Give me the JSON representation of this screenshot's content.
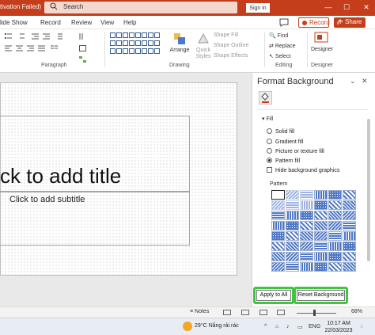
{
  "titlebar": {
    "title": "tivation Failed)",
    "search_placeholder": "Search",
    "signin_label": "Sign in",
    "minimize": "—",
    "maximize": "☐",
    "close": "✕"
  },
  "menu": {
    "items": [
      "lide Show",
      "Record",
      "Review",
      "View",
      "Help"
    ],
    "record_label": "Record",
    "share_label": "Share",
    "share_caret": "▾"
  },
  "ribbon": {
    "groups": {
      "paragraph": "Paragraph",
      "drawing": "Drawing",
      "editing": "Editing",
      "designer": "Designer"
    },
    "arrange_label": "Arrange",
    "quick_styles_label": "Quick Styles",
    "shape_fill": "Shape Fill",
    "shape_outline": "Shape Outline",
    "shape_effects": "Shape Effects",
    "find": "Find",
    "replace": "Replace",
    "select": "Select",
    "designer_label": "Designer"
  },
  "slide": {
    "title_placeholder": "ck to add title",
    "subtitle_placeholder": "Click to add subtitle"
  },
  "pane": {
    "title": "Format Background",
    "fill_section": "Fill",
    "options": [
      "Solid fill",
      "Gradient fill",
      "Picture or texture fill",
      "Pattern fill"
    ],
    "selected_option": "Pattern fill",
    "hide_bg": "Hide background graphics",
    "pattern_label": "Pattern",
    "apply_all": "Apply to All",
    "reset_bg": "Reset Background"
  },
  "statusbar": {
    "notes_label": "Notes",
    "zoom": "68%"
  },
  "taskbar": {
    "temperature": "29°C",
    "weather": "Nắng rải rác",
    "lang": "ENG",
    "time": "10:17 AM",
    "date": "22/03/2023"
  },
  "colors": {
    "accent": "#c43e1c",
    "pattern_fill": "#4f78c8",
    "highlight": "#3fc63f"
  }
}
